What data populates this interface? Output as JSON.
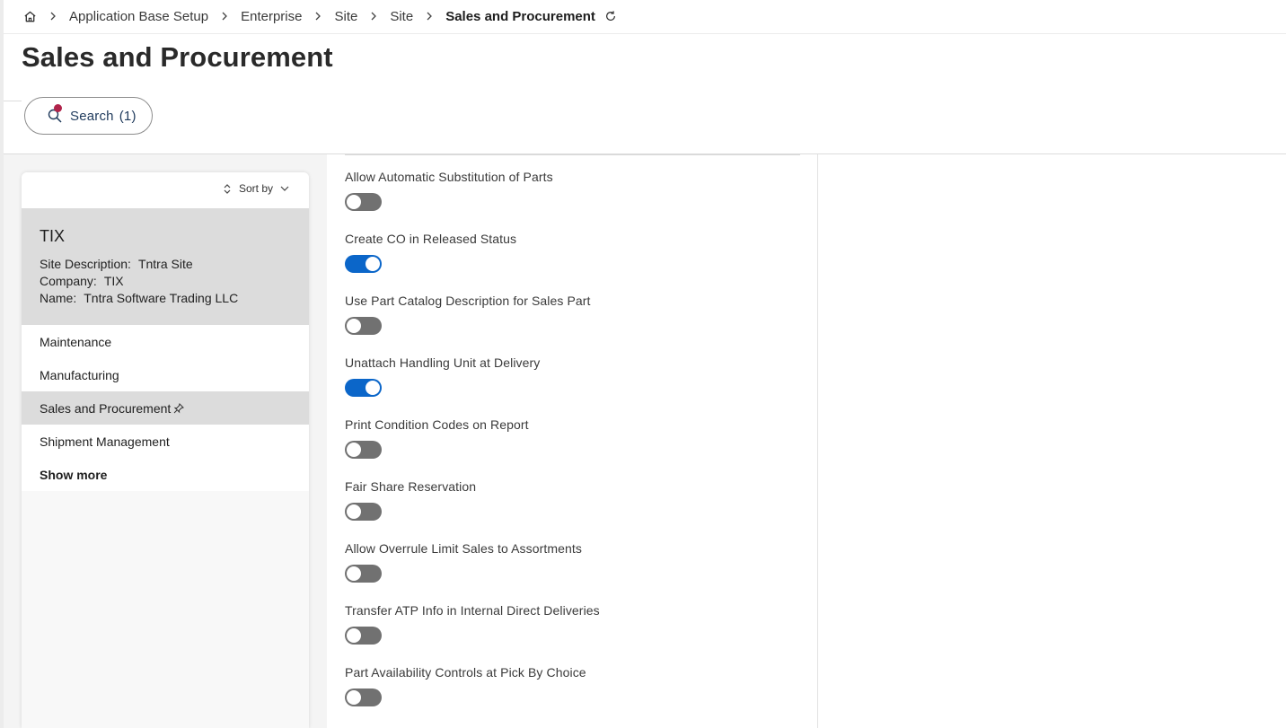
{
  "breadcrumb": {
    "items": [
      "Application Base Setup",
      "Enterprise",
      "Site",
      "Site"
    ],
    "current": "Sales and Procurement"
  },
  "page_title": "Sales and Procurement",
  "search_button": {
    "label": "Search",
    "count": "(1)"
  },
  "list_panel": {
    "sort_label": "Sort by",
    "record": {
      "title": "TIX",
      "site_description_key": "Site Description:",
      "site_description_value": "Tntra Site",
      "company_key": "Company:",
      "company_value": "TIX",
      "name_key": "Name:",
      "name_value": "Tntra Software Trading LLC"
    },
    "nav_items": [
      {
        "label": "Maintenance",
        "active": false
      },
      {
        "label": "Manufacturing",
        "active": false
      },
      {
        "label": "Sales and Procurement",
        "active": true
      },
      {
        "label": "Shipment Management",
        "active": false
      }
    ],
    "show_more": "Show more"
  },
  "form": {
    "fields": [
      {
        "label": "Allow Automatic Substitution of Parts",
        "on": false
      },
      {
        "label": "Create CO in Released Status",
        "on": true
      },
      {
        "label": "Use Part Catalog Description for Sales Part",
        "on": false
      },
      {
        "label": "Unattach Handling Unit at Delivery",
        "on": true
      },
      {
        "label": "Print Condition Codes on Report",
        "on": false
      },
      {
        "label": "Fair Share Reservation",
        "on": false
      },
      {
        "label": "Allow Overrule Limit Sales to Assortments",
        "on": false
      },
      {
        "label": "Transfer ATP Info in Internal Direct Deliveries",
        "on": false
      },
      {
        "label": "Part Availability Controls at Pick By Choice",
        "on": false
      }
    ]
  },
  "colors": {
    "toggle_on": "#0b66c9",
    "toggle_off": "#717171",
    "search_badge": "#b0234a",
    "selected_row": "#dcdcdc"
  }
}
